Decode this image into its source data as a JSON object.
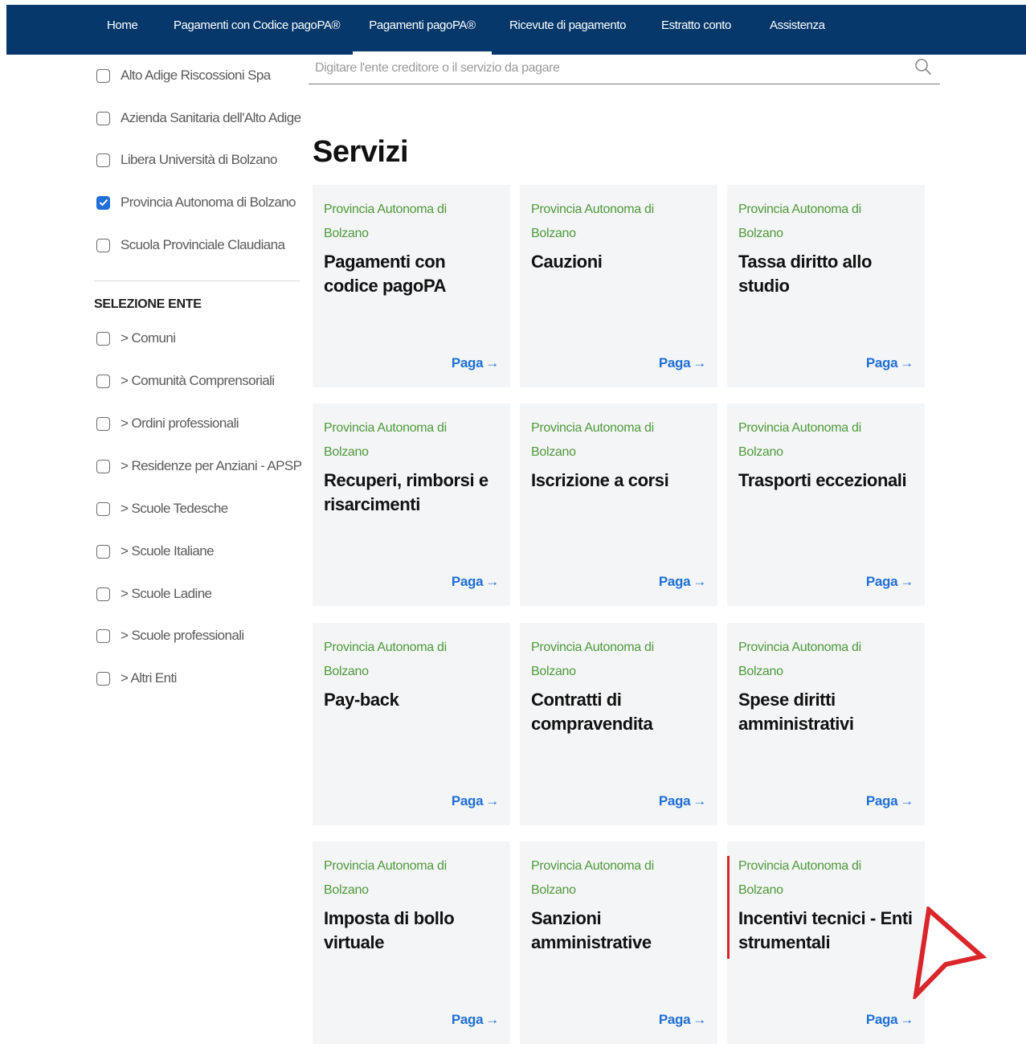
{
  "nav": {
    "items": [
      {
        "label": "Home"
      },
      {
        "label": "Pagamenti con Codice pagoPA®"
      },
      {
        "label": "Pagamenti pagoPA®",
        "active": true
      },
      {
        "label": "Ricevute di pagamento"
      },
      {
        "label": "Estratto conto"
      },
      {
        "label": "Assistenza"
      }
    ],
    "background_color": "#06386b"
  },
  "sidebar": {
    "entities": [
      {
        "label": "Alto Adige Riscossioni Spa",
        "checked": false
      },
      {
        "label": "Azienda Sanitaria dell'Alto Adige",
        "checked": false
      },
      {
        "label": "Libera Università di Bolzano",
        "checked": false
      },
      {
        "label": "Provincia Autonoma di Bolzano",
        "checked": true
      },
      {
        "label": "Scuola Provinciale Claudiana",
        "checked": false
      }
    ],
    "section_heading": "SELEZIONE ENTE",
    "groups": [
      {
        "label": "> Comuni",
        "checked": false
      },
      {
        "label": "> Comunità Comprensoriali",
        "checked": false
      },
      {
        "label": "> Ordini professionali",
        "checked": false
      },
      {
        "label": "> Residenze per Anziani - APSP",
        "checked": false
      },
      {
        "label": "> Scuole Tedesche",
        "checked": false
      },
      {
        "label": "> Scuole Italiane",
        "checked": false
      },
      {
        "label": "> Scuole Ladine",
        "checked": false
      },
      {
        "label": "> Scuole professionali",
        "checked": false
      },
      {
        "label": "> Altri Enti",
        "checked": false
      }
    ]
  },
  "search": {
    "placeholder": "Digitare l'ente creditore o il servizio da pagare",
    "value": "",
    "icon": "search-icon"
  },
  "main": {
    "title": "Servizi",
    "link_label": "Paga",
    "link_arrow": "→",
    "services": [
      {
        "org": "Provincia Autonoma di Bolzano",
        "title": "Pagamenti con codice pagoPA"
      },
      {
        "org": "Provincia Autonoma di Bolzano",
        "title": "Cauzioni"
      },
      {
        "org": "Provincia Autonoma di Bolzano",
        "title": "Tassa diritto allo studio"
      },
      {
        "org": "Provincia Autonoma di Bolzano",
        "title": "Recuperi, rimborsi e risarcimenti"
      },
      {
        "org": "Provincia Autonoma di Bolzano",
        "title": "Iscrizione a corsi"
      },
      {
        "org": "Provincia Autonoma di Bolzano",
        "title": "Trasporti eccezionali"
      },
      {
        "org": "Provincia Autonoma di Bolzano",
        "title": "Pay-back"
      },
      {
        "org": "Provincia Autonoma di Bolzano",
        "title": "Contratti di compravendita"
      },
      {
        "org": "Provincia Autonoma di Bolzano",
        "title": "Spese diritti amministrativi"
      },
      {
        "org": "Provincia Autonoma di Bolzano",
        "title": "Imposta di bollo virtuale"
      },
      {
        "org": "Provincia Autonoma di Bolzano",
        "title": "Sanzioni amministrative"
      },
      {
        "org": "Provincia Autonoma di Bolzano",
        "title": "Incentivi tecnici - Enti strumentali",
        "focused": true
      }
    ]
  },
  "colors": {
    "accent_blue": "#1f6fd6",
    "org_green": "#4e9a3a",
    "card_bg": "#f4f5f7",
    "cursor_red": "#d9262a"
  }
}
